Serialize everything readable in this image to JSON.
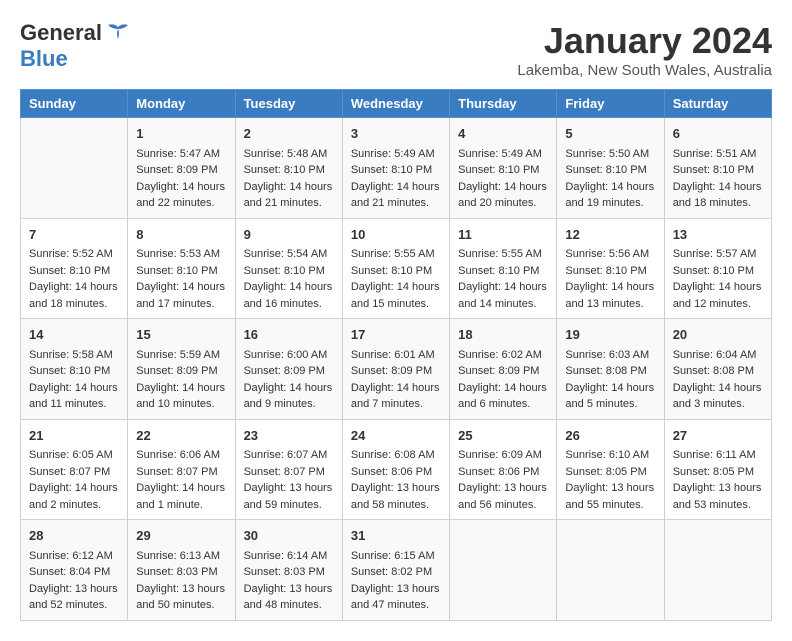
{
  "header": {
    "logo_line1": "General",
    "logo_line2": "Blue",
    "month": "January 2024",
    "location": "Lakemba, New South Wales, Australia"
  },
  "weekdays": [
    "Sunday",
    "Monday",
    "Tuesday",
    "Wednesday",
    "Thursday",
    "Friday",
    "Saturday"
  ],
  "weeks": [
    [
      {
        "day": "",
        "content": ""
      },
      {
        "day": "1",
        "content": "Sunrise: 5:47 AM\nSunset: 8:09 PM\nDaylight: 14 hours\nand 22 minutes."
      },
      {
        "day": "2",
        "content": "Sunrise: 5:48 AM\nSunset: 8:10 PM\nDaylight: 14 hours\nand 21 minutes."
      },
      {
        "day": "3",
        "content": "Sunrise: 5:49 AM\nSunset: 8:10 PM\nDaylight: 14 hours\nand 21 minutes."
      },
      {
        "day": "4",
        "content": "Sunrise: 5:49 AM\nSunset: 8:10 PM\nDaylight: 14 hours\nand 20 minutes."
      },
      {
        "day": "5",
        "content": "Sunrise: 5:50 AM\nSunset: 8:10 PM\nDaylight: 14 hours\nand 19 minutes."
      },
      {
        "day": "6",
        "content": "Sunrise: 5:51 AM\nSunset: 8:10 PM\nDaylight: 14 hours\nand 18 minutes."
      }
    ],
    [
      {
        "day": "7",
        "content": "Sunrise: 5:52 AM\nSunset: 8:10 PM\nDaylight: 14 hours\nand 18 minutes."
      },
      {
        "day": "8",
        "content": "Sunrise: 5:53 AM\nSunset: 8:10 PM\nDaylight: 14 hours\nand 17 minutes."
      },
      {
        "day": "9",
        "content": "Sunrise: 5:54 AM\nSunset: 8:10 PM\nDaylight: 14 hours\nand 16 minutes."
      },
      {
        "day": "10",
        "content": "Sunrise: 5:55 AM\nSunset: 8:10 PM\nDaylight: 14 hours\nand 15 minutes."
      },
      {
        "day": "11",
        "content": "Sunrise: 5:55 AM\nSunset: 8:10 PM\nDaylight: 14 hours\nand 14 minutes."
      },
      {
        "day": "12",
        "content": "Sunrise: 5:56 AM\nSunset: 8:10 PM\nDaylight: 14 hours\nand 13 minutes."
      },
      {
        "day": "13",
        "content": "Sunrise: 5:57 AM\nSunset: 8:10 PM\nDaylight: 14 hours\nand 12 minutes."
      }
    ],
    [
      {
        "day": "14",
        "content": "Sunrise: 5:58 AM\nSunset: 8:10 PM\nDaylight: 14 hours\nand 11 minutes."
      },
      {
        "day": "15",
        "content": "Sunrise: 5:59 AM\nSunset: 8:09 PM\nDaylight: 14 hours\nand 10 minutes."
      },
      {
        "day": "16",
        "content": "Sunrise: 6:00 AM\nSunset: 8:09 PM\nDaylight: 14 hours\nand 9 minutes."
      },
      {
        "day": "17",
        "content": "Sunrise: 6:01 AM\nSunset: 8:09 PM\nDaylight: 14 hours\nand 7 minutes."
      },
      {
        "day": "18",
        "content": "Sunrise: 6:02 AM\nSunset: 8:09 PM\nDaylight: 14 hours\nand 6 minutes."
      },
      {
        "day": "19",
        "content": "Sunrise: 6:03 AM\nSunset: 8:08 PM\nDaylight: 14 hours\nand 5 minutes."
      },
      {
        "day": "20",
        "content": "Sunrise: 6:04 AM\nSunset: 8:08 PM\nDaylight: 14 hours\nand 3 minutes."
      }
    ],
    [
      {
        "day": "21",
        "content": "Sunrise: 6:05 AM\nSunset: 8:07 PM\nDaylight: 14 hours\nand 2 minutes."
      },
      {
        "day": "22",
        "content": "Sunrise: 6:06 AM\nSunset: 8:07 PM\nDaylight: 14 hours\nand 1 minute."
      },
      {
        "day": "23",
        "content": "Sunrise: 6:07 AM\nSunset: 8:07 PM\nDaylight: 13 hours\nand 59 minutes."
      },
      {
        "day": "24",
        "content": "Sunrise: 6:08 AM\nSunset: 8:06 PM\nDaylight: 13 hours\nand 58 minutes."
      },
      {
        "day": "25",
        "content": "Sunrise: 6:09 AM\nSunset: 8:06 PM\nDaylight: 13 hours\nand 56 minutes."
      },
      {
        "day": "26",
        "content": "Sunrise: 6:10 AM\nSunset: 8:05 PM\nDaylight: 13 hours\nand 55 minutes."
      },
      {
        "day": "27",
        "content": "Sunrise: 6:11 AM\nSunset: 8:05 PM\nDaylight: 13 hours\nand 53 minutes."
      }
    ],
    [
      {
        "day": "28",
        "content": "Sunrise: 6:12 AM\nSunset: 8:04 PM\nDaylight: 13 hours\nand 52 minutes."
      },
      {
        "day": "29",
        "content": "Sunrise: 6:13 AM\nSunset: 8:03 PM\nDaylight: 13 hours\nand 50 minutes."
      },
      {
        "day": "30",
        "content": "Sunrise: 6:14 AM\nSunset: 8:03 PM\nDaylight: 13 hours\nand 48 minutes."
      },
      {
        "day": "31",
        "content": "Sunrise: 6:15 AM\nSunset: 8:02 PM\nDaylight: 13 hours\nand 47 minutes."
      },
      {
        "day": "",
        "content": ""
      },
      {
        "day": "",
        "content": ""
      },
      {
        "day": "",
        "content": ""
      }
    ]
  ]
}
